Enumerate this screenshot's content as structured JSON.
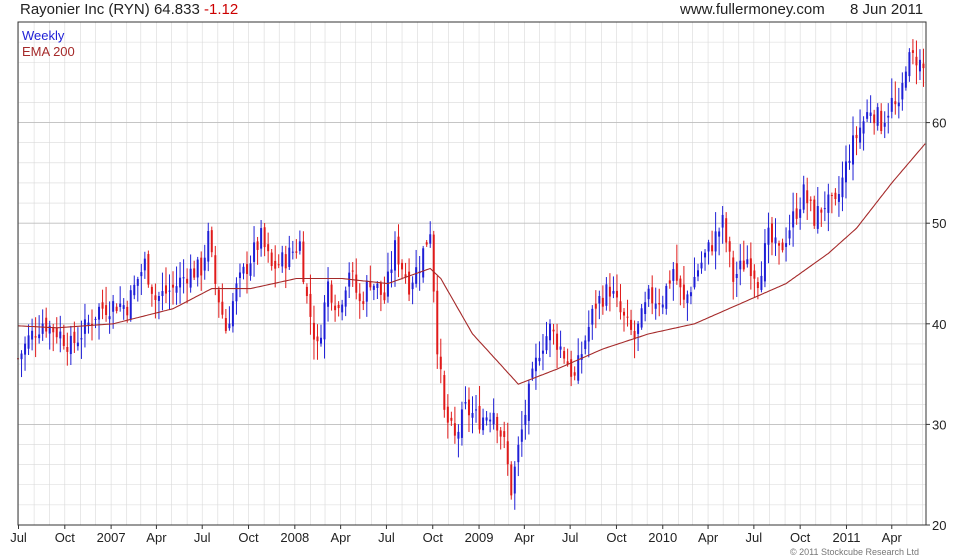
{
  "header": {
    "company": "Rayonier Inc (RYN)",
    "price": "64.833",
    "change": "-1.12",
    "site": "www.fullermoney.com",
    "date": "8 Jun 2011"
  },
  "legend": {
    "series1": "Weekly",
    "series2": "EMA 200"
  },
  "credit": "© 2011 Stockcube Research Ltd",
  "colors": {
    "up": "#1f1fd6",
    "down": "#e01a1a",
    "ema": "#a52a2a",
    "grid": "#d9d9d9",
    "legend_weekly": "#1f1fd6",
    "legend_ema": "#a52a2a"
  },
  "chart_data": {
    "type": "candlestick",
    "x_start": "2006-06-30",
    "x_end": "2011-06-08",
    "x_ticks": [
      {
        "label": "Jul",
        "date": "2006-07-01"
      },
      {
        "label": "Oct",
        "date": "2006-10-01"
      },
      {
        "label": "2007",
        "date": "2007-01-01"
      },
      {
        "label": "Apr",
        "date": "2007-04-01"
      },
      {
        "label": "Jul",
        "date": "2007-07-01"
      },
      {
        "label": "Oct",
        "date": "2007-10-01"
      },
      {
        "label": "2008",
        "date": "2008-01-01"
      },
      {
        "label": "Apr",
        "date": "2008-04-01"
      },
      {
        "label": "Jul",
        "date": "2008-07-01"
      },
      {
        "label": "Oct",
        "date": "2008-10-01"
      },
      {
        "label": "2009",
        "date": "2009-01-01"
      },
      {
        "label": "Apr",
        "date": "2009-04-01"
      },
      {
        "label": "Jul",
        "date": "2009-07-01"
      },
      {
        "label": "Oct",
        "date": "2009-10-01"
      },
      {
        "label": "2010",
        "date": "2010-01-01"
      },
      {
        "label": "Apr",
        "date": "2010-04-01"
      },
      {
        "label": "Jul",
        "date": "2010-07-01"
      },
      {
        "label": "Oct",
        "date": "2010-10-01"
      },
      {
        "label": "2011",
        "date": "2011-01-01"
      },
      {
        "label": "Apr",
        "date": "2011-04-01"
      }
    ],
    "y_ticks": [
      20,
      30,
      40,
      50,
      60
    ],
    "ylim": [
      20,
      70
    ],
    "grid": true,
    "legend_position": "top-left",
    "close_anchors": [
      [
        "2006-06-30",
        36.5
      ],
      [
        "2006-07-21",
        38.5
      ],
      [
        "2006-08-18",
        40.2
      ],
      [
        "2006-09-22",
        39.0
      ],
      [
        "2006-10-13",
        37.8
      ],
      [
        "2006-11-10",
        39.5
      ],
      [
        "2006-12-08",
        41.5
      ],
      [
        "2007-01-12",
        42.0
      ],
      [
        "2007-02-02",
        41.8
      ],
      [
        "2007-02-23",
        44.5
      ],
      [
        "2007-03-09",
        46.0
      ],
      [
        "2007-03-30",
        42.5
      ],
      [
        "2007-05-04",
        43.5
      ],
      [
        "2007-06-01",
        45.0
      ],
      [
        "2007-06-29",
        45.5
      ],
      [
        "2007-07-13",
        48.5
      ],
      [
        "2007-07-27",
        44.0
      ],
      [
        "2007-08-17",
        39.5
      ],
      [
        "2007-09-07",
        43.5
      ],
      [
        "2007-10-05",
        46.5
      ],
      [
        "2007-10-26",
        48.5
      ],
      [
        "2007-11-16",
        45.5
      ],
      [
        "2007-12-14",
        46.5
      ],
      [
        "2008-01-11",
        48.0
      ],
      [
        "2008-01-25",
        42.5
      ],
      [
        "2008-02-15",
        37.5
      ],
      [
        "2008-03-07",
        44.0
      ],
      [
        "2008-03-28",
        41.5
      ],
      [
        "2008-04-18",
        45.5
      ],
      [
        "2008-05-09",
        42.0
      ],
      [
        "2008-05-30",
        44.5
      ],
      [
        "2008-06-27",
        42.5
      ],
      [
        "2008-07-18",
        47.5
      ],
      [
        "2008-08-15",
        44.0
      ],
      [
        "2008-09-05",
        46.0
      ],
      [
        "2008-09-26",
        49.5
      ],
      [
        "2008-10-10",
        38.0
      ],
      [
        "2008-10-24",
        31.0
      ],
      [
        "2008-11-14",
        28.5
      ],
      [
        "2008-12-05",
        31.5
      ],
      [
        "2009-01-02",
        30.5
      ],
      [
        "2009-01-30",
        31.5
      ],
      [
        "2009-02-20",
        28.0
      ],
      [
        "2009-03-06",
        23.5
      ],
      [
        "2009-03-20",
        27.5
      ],
      [
        "2009-04-10",
        33.0
      ],
      [
        "2009-05-01",
        37.5
      ],
      [
        "2009-05-22",
        39.5
      ],
      [
        "2009-06-19",
        37.0
      ],
      [
        "2009-07-10",
        34.5
      ],
      [
        "2009-07-31",
        38.5
      ],
      [
        "2009-08-21",
        42.0
      ],
      [
        "2009-09-18",
        43.5
      ],
      [
        "2009-10-09",
        41.0
      ],
      [
        "2009-11-06",
        38.5
      ],
      [
        "2009-12-04",
        42.5
      ],
      [
        "2010-01-01",
        42.5
      ],
      [
        "2010-01-22",
        45.5
      ],
      [
        "2010-02-12",
        42.0
      ],
      [
        "2010-03-12",
        45.5
      ],
      [
        "2010-04-09",
        48.0
      ],
      [
        "2010-04-30",
        50.0
      ],
      [
        "2010-05-21",
        44.5
      ],
      [
        "2010-06-18",
        46.5
      ],
      [
        "2010-07-09",
        44.5
      ],
      [
        "2010-07-30",
        48.5
      ],
      [
        "2010-08-20",
        47.0
      ],
      [
        "2010-09-17",
        50.5
      ],
      [
        "2010-10-08",
        53.0
      ],
      [
        "2010-10-29",
        50.5
      ],
      [
        "2010-11-19",
        52.0
      ],
      [
        "2010-12-10",
        51.5
      ],
      [
        "2011-01-07",
        57.0
      ],
      [
        "2011-01-28",
        59.5
      ],
      [
        "2011-02-18",
        61.5
      ],
      [
        "2011-03-11",
        60.0
      ],
      [
        "2011-04-01",
        62.0
      ],
      [
        "2011-04-15",
        61.0
      ],
      [
        "2011-04-29",
        66.0
      ],
      [
        "2011-05-20",
        66.5
      ],
      [
        "2011-06-08",
        64.8
      ]
    ],
    "ema_anchors": [
      [
        "2006-06-30",
        39.8
      ],
      [
        "2006-09-15",
        39.6
      ],
      [
        "2007-01-05",
        40.0
      ],
      [
        "2007-05-04",
        41.5
      ],
      [
        "2007-07-20",
        43.5
      ],
      [
        "2007-10-05",
        43.5
      ],
      [
        "2008-01-04",
        44.5
      ],
      [
        "2008-04-04",
        44.5
      ],
      [
        "2008-07-04",
        44.0
      ],
      [
        "2008-09-26",
        45.5
      ],
      [
        "2008-10-17",
        44.5
      ],
      [
        "2008-12-19",
        39.0
      ],
      [
        "2009-03-20",
        34.0
      ],
      [
        "2009-06-05",
        35.5
      ],
      [
        "2009-09-04",
        37.5
      ],
      [
        "2009-12-04",
        39.0
      ],
      [
        "2010-03-05",
        40.0
      ],
      [
        "2010-06-04",
        42.0
      ],
      [
        "2010-09-03",
        44.0
      ],
      [
        "2010-11-26",
        47.0
      ],
      [
        "2011-01-21",
        49.5
      ],
      [
        "2011-04-01",
        54.0
      ],
      [
        "2011-06-08",
        58.0
      ]
    ]
  }
}
